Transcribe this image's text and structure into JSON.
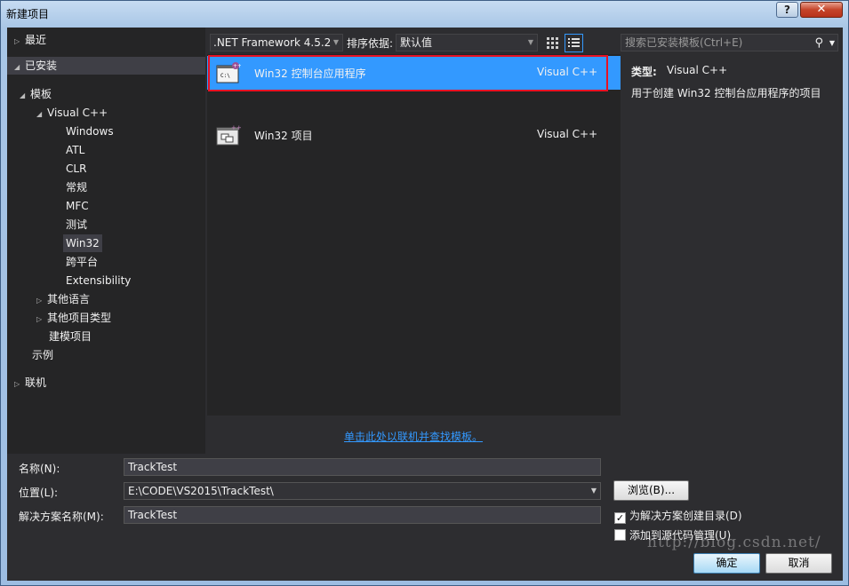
{
  "window": {
    "title": "新建项目",
    "help_label": "?",
    "close_label": "✕"
  },
  "tree": {
    "recent": "最近",
    "installed": "已安装",
    "templates": "模板",
    "visual_cpp": "Visual C++",
    "children": [
      "Windows",
      "ATL",
      "CLR",
      "常规",
      "MFC",
      "测试",
      "Win32",
      "跨平台",
      "Extensibility"
    ],
    "other_languages": "其他语言",
    "other_project_types": "其他项目类型",
    "modeling_projects": "建模项目",
    "samples": "示例",
    "online": "联机"
  },
  "toolbar": {
    "framework": ".NET Framework 4.5.2",
    "sort_label": "排序依据:",
    "sort_value": "默认值",
    "search_placeholder": "搜索已安装模板(Ctrl+E)"
  },
  "templates": [
    {
      "name": "Win32 控制台应用程序",
      "language": "Visual C++",
      "selected": true,
      "icon": "console-app-icon"
    },
    {
      "name": "Win32 项目",
      "language": "Visual C++",
      "selected": false,
      "icon": "win32-project-icon"
    }
  ],
  "description": {
    "type_label": "类型:",
    "type_value": "Visual C++",
    "text": "用于创建 Win32 控制台应用程序的项目"
  },
  "online_link": "单击此处以联机并查找模板。",
  "form": {
    "name_label": "名称(N):",
    "name_value": "TrackTest",
    "location_label": "位置(L):",
    "location_value": "E:\\CODE\\VS2015\\TrackTest\\",
    "solution_label": "解决方案名称(M):",
    "solution_value": "TrackTest",
    "browse_label": "浏览(B)...",
    "create_dir_label": "为解决方案创建目录(D)",
    "create_dir_checked": true,
    "source_control_label": "添加到源代码管理(U)",
    "source_control_checked": false,
    "ok_label": "确定",
    "cancel_label": "取消"
  },
  "watermark": "http://blog.csdn.net/",
  "colors": {
    "accent": "#3399ff",
    "highlight_frame": "#e81123",
    "background": "#2d2d30"
  }
}
